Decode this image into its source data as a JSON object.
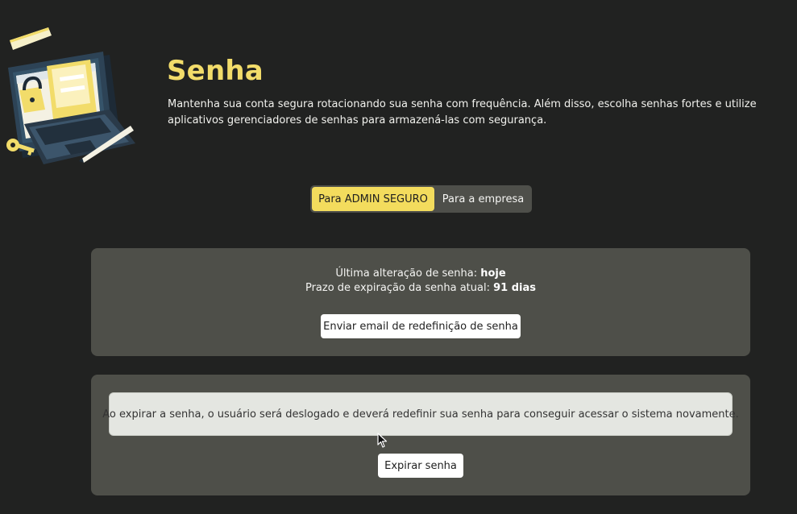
{
  "header": {
    "title": "Senha",
    "description": "Mantenha sua conta segura rotacionando sua senha com frequência. Além disso, escolha senhas fortes e utilize aplicativos gerenciadores de senhas para armazená-las com segurança."
  },
  "tabs": [
    {
      "label": "Para ADMIN SEGURO",
      "active": true
    },
    {
      "label": "Para a empresa",
      "active": false
    }
  ],
  "password_card": {
    "last_change_label": "Última alteração de senha:",
    "last_change_value": "hoje",
    "expiry_label": "Prazo de expiração da senha atual:",
    "expiry_value": "91 dias",
    "reset_button": "Enviar email de redefinição de senha"
  },
  "expire_card": {
    "notice": "Ao expirar a senha, o usuário será deslogado e deverá redefinir sua senha para conseguir acessar o sistema novamente.",
    "expire_button": "Expirar senha"
  },
  "colors": {
    "background": "#212221",
    "accent": "#f3dc5d",
    "card": "#4e4f49"
  },
  "icons": {
    "illustration": "laptop-padlock-key-illustration",
    "cursor": "mouse-pointer-icon"
  }
}
